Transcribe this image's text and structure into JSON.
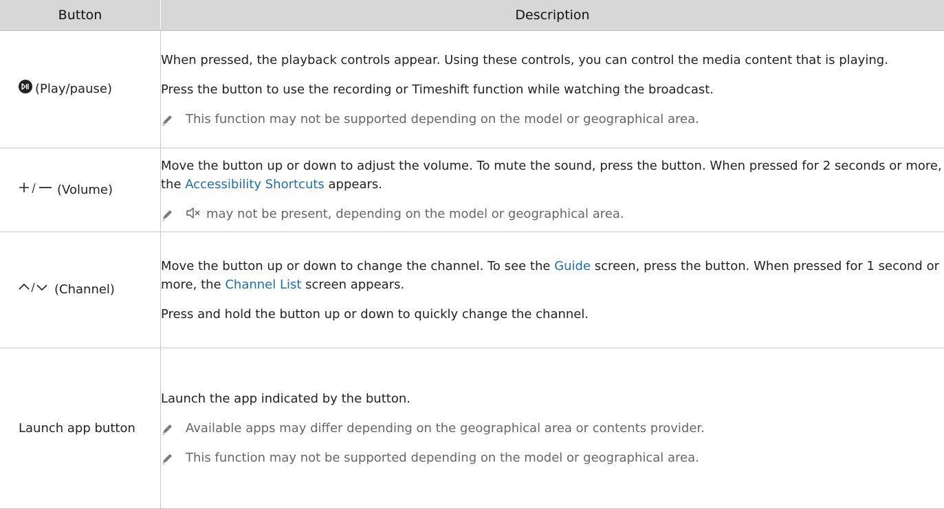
{
  "headers": {
    "button": "Button",
    "description": "Description"
  },
  "rows": [
    {
      "button": {
        "icon": "play-pause-icon",
        "label": "(Play/pause)"
      },
      "desc1": "When pressed, the playback controls appear. Using these controls, you can control the media content that is playing.",
      "desc2": "Press the button to use the recording or Timeshift function while watching the broadcast.",
      "note1": "This function may not be supported depending on the model or geographical area."
    },
    {
      "button": {
        "icon": "plus-minus-icon",
        "label": "(Volume)"
      },
      "desc1_a": "Move the button up or down to adjust the volume. To mute the sound, press the button. When pressed for 2 seconds or more, the ",
      "link": "Accessibility Shortcuts",
      "desc1_b": " appears.",
      "note1": "may not be present, depending on the model or geographical area."
    },
    {
      "button": {
        "icon": "chevron-up-down-icon",
        "label": "(Channel)"
      },
      "desc1_a": "Move the button up or down to change the channel. To see the ",
      "link1": "Guide",
      "desc1_b": " screen, press the button. When pressed for 1 second or more, the ",
      "link2": "Channel List",
      "desc1_c": " screen appears.",
      "desc2": "Press and hold the button up or down to quickly change the channel."
    },
    {
      "button": {
        "label": "Launch app button"
      },
      "desc1": "Launch the app indicated by the button.",
      "note1": "Available apps may differ depending on the geographical area or contents provider.",
      "note2": "This function may not be supported depending on the model or geographical area."
    }
  ],
  "colors": {
    "header_bg": "#d7d7d7",
    "link": "#1a6fb5",
    "note_text": "#666666"
  }
}
